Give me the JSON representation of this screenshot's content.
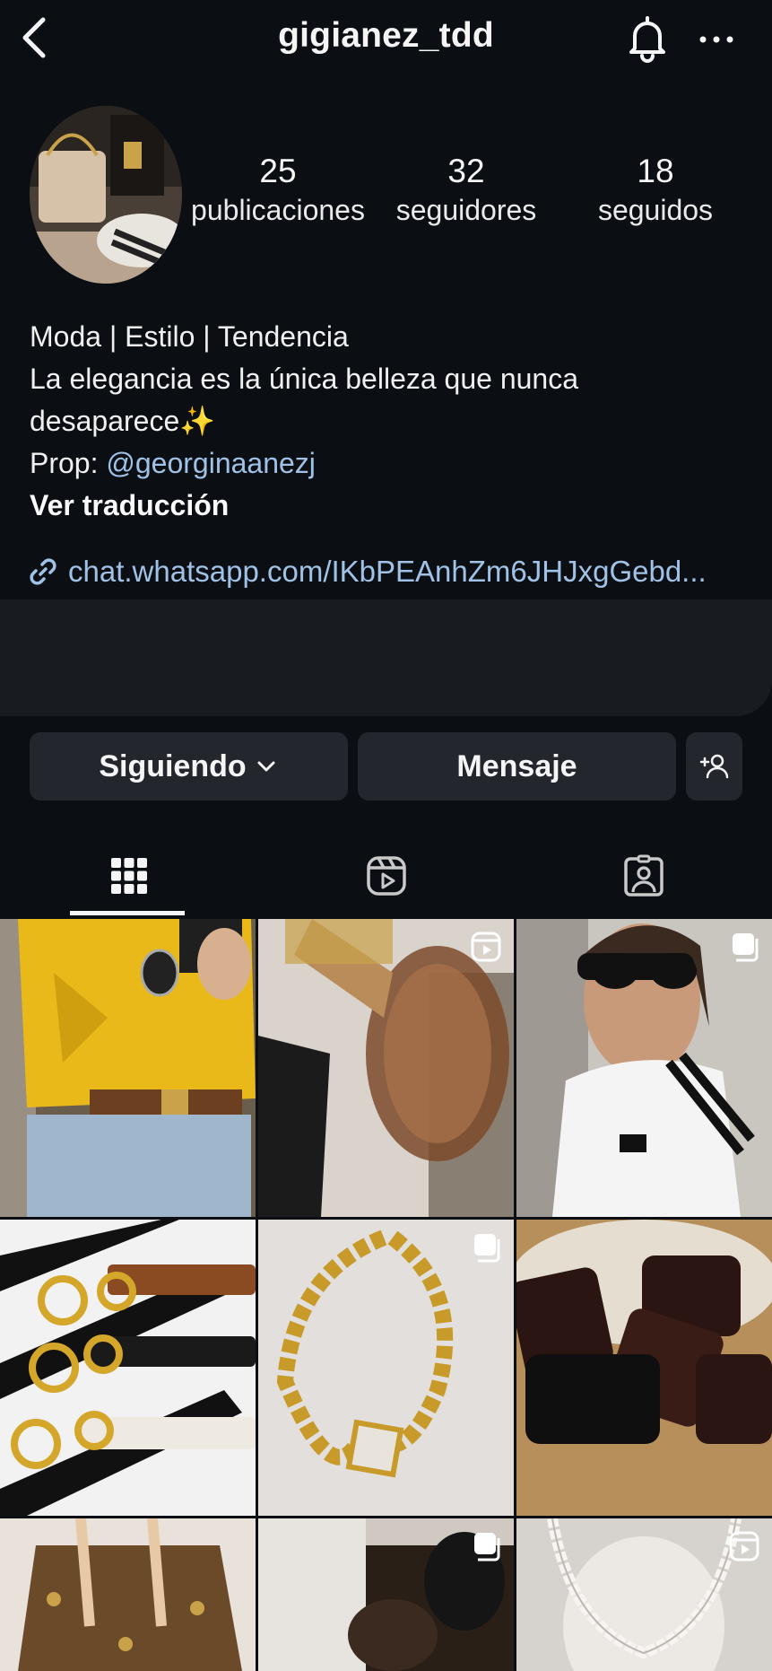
{
  "header": {
    "username": "gigianez_tdd"
  },
  "stats": [
    {
      "value": "25",
      "label": "publicaciones"
    },
    {
      "value": "32",
      "label": "seguidores"
    },
    {
      "value": "18",
      "label": "seguidos"
    }
  ],
  "bio": {
    "line1": "Moda | Estilo | Tendencia",
    "line2": "La elegancia es la única belleza que nunca",
    "line3": "desaparece",
    "line3_emoji": "✨",
    "prop_prefix": "Prop: ",
    "prop_mention": "@georginaanezj",
    "translate": "Ver traducción",
    "link": "chat.whatsapp.com/IKbPEAnhZm6JHJxgGebd..."
  },
  "actions": {
    "following_label": "Siguiendo",
    "message_label": "Mensaje"
  },
  "tabs": [
    {
      "icon": "grid-icon",
      "active": true
    },
    {
      "icon": "reels-icon",
      "active": false
    },
    {
      "icon": "tagged-icon",
      "active": false
    }
  ],
  "posts": [
    {
      "subject": "yellow-shirt-belt-outfit",
      "badge": null
    },
    {
      "subject": "sunglasses-closeup",
      "badge": "reel-icon"
    },
    {
      "subject": "selfie-adidas-tee",
      "badge": "carousel-icon"
    },
    {
      "subject": "gold-horsebit-belts",
      "badge": null
    },
    {
      "subject": "gold-chain-bracelet",
      "badge": "carousel-icon"
    },
    {
      "subject": "miu-miu-hair-claws",
      "badge": null
    },
    {
      "subject": "monogram-tote-bag",
      "badge": null
    },
    {
      "subject": "dark-sunglasses",
      "badge": "carousel-icon"
    },
    {
      "subject": "pearl-necklace",
      "badge": "reel-icon"
    }
  ],
  "colors": {
    "background": "#0b0f14",
    "button": "#23262d",
    "link": "#9fc2e6",
    "text": "#f5f5f5"
  }
}
